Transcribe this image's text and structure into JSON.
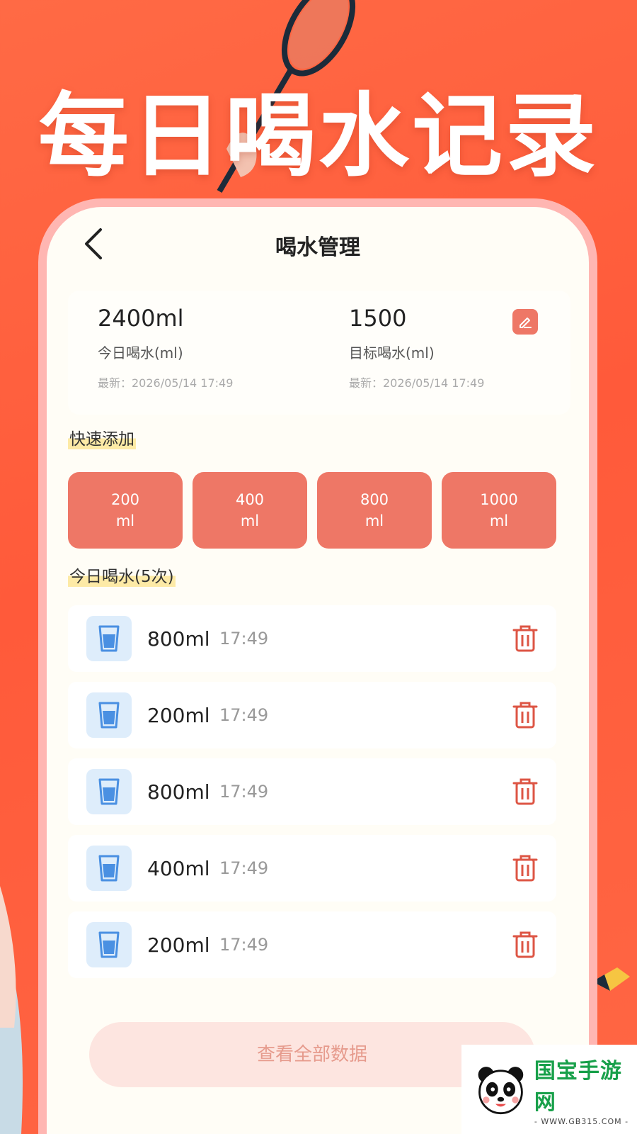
{
  "promo": {
    "title": "每日喝水记录"
  },
  "nav": {
    "title": "喝水管理",
    "back_icon": "chevron-left-icon"
  },
  "stats": {
    "today": {
      "value": "2400ml",
      "label": "今日喝水(ml)",
      "updated": "最新：2026/05/14 17:49"
    },
    "goal": {
      "value": "1500",
      "label": "目标喝水(ml)",
      "updated": "最新：2026/05/14 17:49",
      "edit_icon": "edit-icon"
    }
  },
  "quick_add": {
    "title": "快速添加",
    "options": [
      {
        "amount": "200",
        "unit": "ml"
      },
      {
        "amount": "400",
        "unit": "ml"
      },
      {
        "amount": "800",
        "unit": "ml"
      },
      {
        "amount": "1000",
        "unit": "ml"
      }
    ]
  },
  "records": {
    "title": "今日喝水(5次)",
    "items": [
      {
        "amount": "800ml",
        "time": "17:49"
      },
      {
        "amount": "200ml",
        "time": "17:49"
      },
      {
        "amount": "800ml",
        "time": "17:49"
      },
      {
        "amount": "400ml",
        "time": "17:49"
      },
      {
        "amount": "200ml",
        "time": "17:49"
      }
    ]
  },
  "footer": {
    "view_all": "查看全部数据"
  },
  "watermark": {
    "name": "国宝手游网",
    "url": "- WWW.GB315.COM -"
  },
  "colors": {
    "background": "#ff5a3a",
    "accent": "#ee7766",
    "frame": "#ffb6b2",
    "cup_bg": "#deedfb",
    "cup": "#4a90e2"
  }
}
